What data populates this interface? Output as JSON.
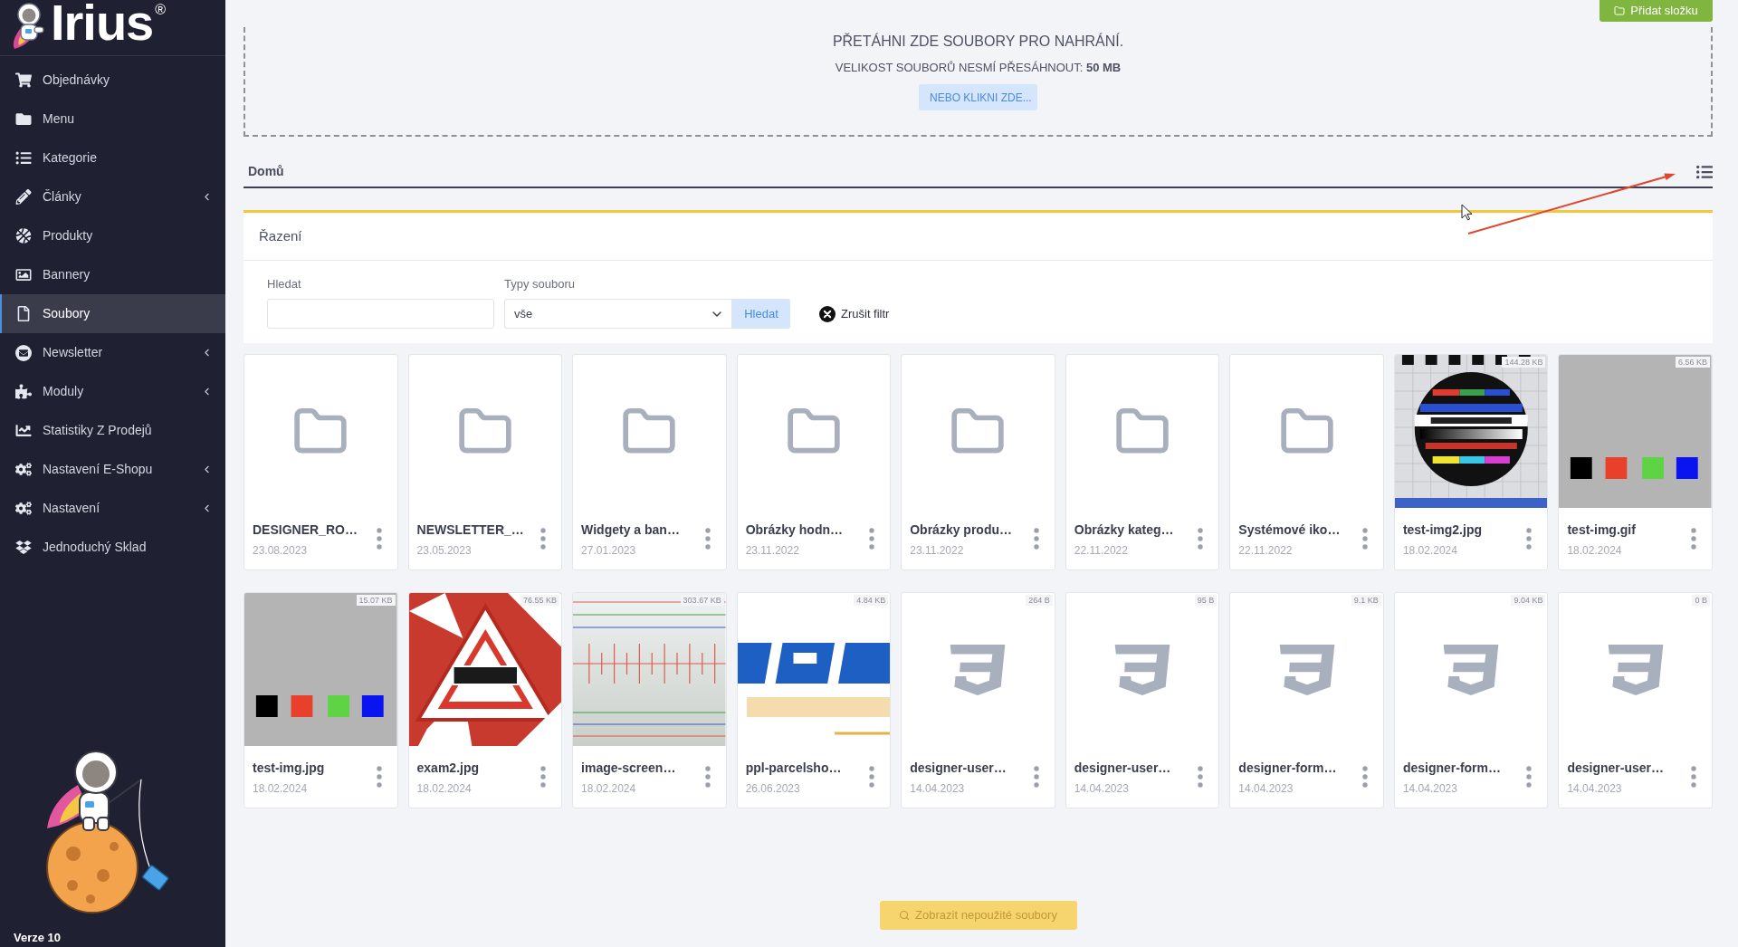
{
  "sidebar": {
    "logo": "Irius",
    "logo_mark": "®",
    "items": [
      {
        "label": "Objednávky",
        "selected": false,
        "expandable": false
      },
      {
        "label": "Menu",
        "selected": false,
        "expandable": false
      },
      {
        "label": "Kategorie",
        "selected": false,
        "expandable": false
      },
      {
        "label": "Články",
        "selected": false,
        "expandable": true
      },
      {
        "label": "Produkty",
        "selected": false,
        "expandable": false
      },
      {
        "label": "Bannery",
        "selected": false,
        "expandable": false
      },
      {
        "label": "Soubory",
        "selected": true,
        "expandable": false
      },
      {
        "label": "Newsletter",
        "selected": false,
        "expandable": true
      },
      {
        "label": "Moduly",
        "selected": false,
        "expandable": true
      },
      {
        "label": "Statistiky Z Prodejů",
        "selected": false,
        "expandable": false
      },
      {
        "label": "Nastavení E-Shopu",
        "selected": false,
        "expandable": true
      },
      {
        "label": "Nastavení",
        "selected": false,
        "expandable": true
      },
      {
        "label": "Jednoduchý Sklad",
        "selected": false,
        "expandable": false
      }
    ],
    "version": "Verze 10"
  },
  "toolbar": {
    "add_folder_button": "Přidat složku"
  },
  "upload": {
    "title": "PŘETÁHNI ZDE SOUBORY PRO NAHRÁNÍ.",
    "limit": "VELIKOST SOUBORŮ NESMÍ PŘESÁHNOUT: **50 MB**",
    "button": "NEBO KLIKNI ZDE..."
  },
  "breadcrumb": {
    "path": "Domů"
  },
  "sort_panel": {
    "title": "Řazení",
    "search": {
      "label": "Hledat"
    },
    "file_type": {
      "label": "Typy souboru",
      "value": "vše"
    },
    "search_button": "Hledat",
    "clear_button": "Zrušit filtr"
  },
  "files": [
    {
      "kind": "folder",
      "name": "DESIGNER_RO…",
      "date": "23.08.2023"
    },
    {
      "kind": "folder",
      "name": "NEWSLETTER_…",
      "date": "23.05.2023"
    },
    {
      "kind": "folder",
      "name": "Widgety a ban…",
      "date": "27.01.2023"
    },
    {
      "kind": "folder",
      "name": "Obrázky hodn…",
      "date": "23.11.2022"
    },
    {
      "kind": "folder",
      "name": "Obrázky produ…",
      "date": "23.11.2022"
    },
    {
      "kind": "folder",
      "name": "Obrázky kateg…",
      "date": "22.11.2022"
    },
    {
      "kind": "folder",
      "name": "Systémové iko…",
      "date": "22.11.2022"
    },
    {
      "kind": "testcard",
      "name": "test-img2.jpg",
      "date": "18.02.2024",
      "size": "144.28 KB"
    },
    {
      "kind": "swatches",
      "name": "test-img.gif",
      "date": "18.02.2024",
      "size": "6.56 KB"
    },
    {
      "kind": "swatches",
      "name": "test-img.jpg",
      "date": "18.02.2024",
      "size": "15.07 KB"
    },
    {
      "kind": "warning",
      "name": "exam2.jpg",
      "date": "18.02.2024",
      "size": "76.55 KB"
    },
    {
      "kind": "screenshot",
      "name": "image-screen…",
      "date": "18.02.2024",
      "size": "303.67 KB"
    },
    {
      "kind": "logo",
      "name": "ppl-parcelsho…",
      "date": "26.06.2023",
      "size": "4.84 KB"
    },
    {
      "kind": "stylesheet",
      "name": "designer-user…",
      "date": "14.04.2023",
      "size": "264 B"
    },
    {
      "kind": "stylesheet",
      "name": "designer-user…",
      "date": "14.04.2023",
      "size": "95 B"
    },
    {
      "kind": "stylesheet",
      "name": "designer-form…",
      "date": "14.04.2023",
      "size": "9.1 KB"
    },
    {
      "kind": "stylesheet",
      "name": "designer-form…",
      "date": "14.04.2023",
      "size": "9.04 KB"
    },
    {
      "kind": "stylesheet",
      "name": "designer-user…",
      "date": "14.04.2023",
      "size": "0 B"
    }
  ],
  "unused_button": "Zobrazit nepoužité soubory"
}
